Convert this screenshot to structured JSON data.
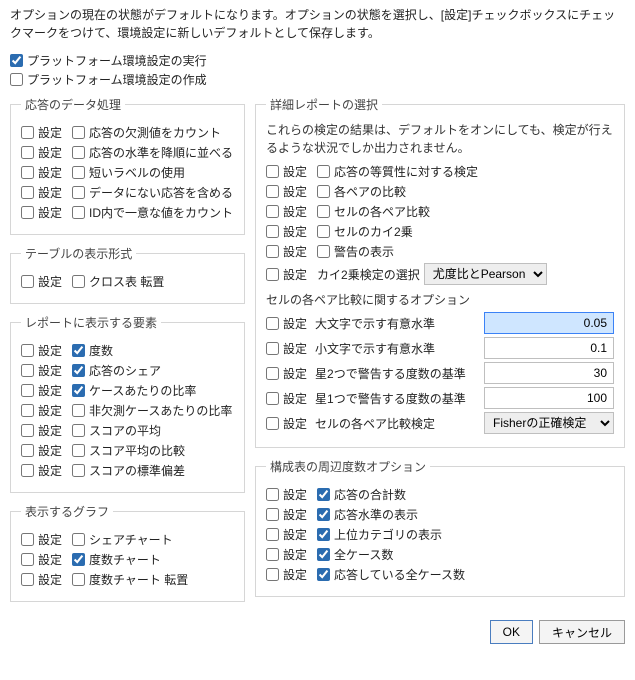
{
  "intro": "オプションの現在の状態がデフォルトになります。オプションの状態を選択し、[設定]チェックボックスにチェックマークをつけて、環境設定に新しいデフォルトとして保存します。",
  "set_label": "設定",
  "top": {
    "run": {
      "checked": true,
      "label": "プラットフォーム環境設定の実行"
    },
    "create": {
      "checked": false,
      "label": "プラットフォーム環境設定の作成"
    }
  },
  "group_data": {
    "title": "応答のデータ処理",
    "items": [
      {
        "set": false,
        "on": false,
        "label": "応答の欠測値をカウント"
      },
      {
        "set": false,
        "on": false,
        "label": "応答の水準を降順に並べる"
      },
      {
        "set": false,
        "on": false,
        "label": "短いラベルの使用"
      },
      {
        "set": false,
        "on": false,
        "label": "データにない応答を含める"
      },
      {
        "set": false,
        "on": false,
        "label": "ID内で一意な値をカウント"
      }
    ]
  },
  "group_table": {
    "title": "テーブルの表示形式",
    "items": [
      {
        "set": false,
        "on": false,
        "label": "クロス表 転置"
      }
    ]
  },
  "group_report": {
    "title": "レポートに表示する要素",
    "items": [
      {
        "set": false,
        "on": true,
        "label": "度数"
      },
      {
        "set": false,
        "on": true,
        "label": "応答のシェア"
      },
      {
        "set": false,
        "on": true,
        "label": "ケースあたりの比率"
      },
      {
        "set": false,
        "on": false,
        "label": "非欠測ケースあたりの比率"
      },
      {
        "set": false,
        "on": false,
        "label": "スコアの平均"
      },
      {
        "set": false,
        "on": false,
        "label": "スコア平均の比較"
      },
      {
        "set": false,
        "on": false,
        "label": "スコアの標準偏差"
      }
    ]
  },
  "group_graph": {
    "title": "表示するグラフ",
    "items": [
      {
        "set": false,
        "on": false,
        "label": "シェアチャート"
      },
      {
        "set": false,
        "on": true,
        "label": "度数チャート"
      },
      {
        "set": false,
        "on": false,
        "label": "度数チャート 転置"
      }
    ]
  },
  "group_detail": {
    "title": "詳細レポートの選択",
    "desc": "これらの検定の結果は、デフォルトをオンにしても、検定が行えるような状況でしか出力されません。",
    "items": [
      {
        "set": false,
        "on": false,
        "label": "応答の等質性に対する検定"
      },
      {
        "set": false,
        "on": false,
        "label": "各ペアの比較"
      },
      {
        "set": false,
        "on": false,
        "label": "セルの各ペア比較"
      },
      {
        "set": false,
        "on": false,
        "label": "セルのカイ2乗"
      },
      {
        "set": false,
        "on": false,
        "label": "警告の表示"
      }
    ],
    "chi_row": {
      "set": false,
      "label": "カイ2乗検定の選択",
      "select": "尤度比とPearson"
    },
    "pair_header": "セルの各ペア比較に関するオプション",
    "val_rows": [
      {
        "set": false,
        "label": "大文字で示す有意水準",
        "value": "0.05",
        "focus": true
      },
      {
        "set": false,
        "label": "小文字で示す有意水準",
        "value": "0.1",
        "focus": false
      },
      {
        "set": false,
        "label": "星2つで警告する度数の基準",
        "value": "30",
        "focus": false
      },
      {
        "set": false,
        "label": "星1つで警告する度数の基準",
        "value": "100",
        "focus": false
      }
    ],
    "test_row": {
      "set": false,
      "label": "セルの各ペア比較検定",
      "select": "Fisherの正確検定"
    }
  },
  "group_margin": {
    "title": "構成表の周辺度数オプション",
    "items": [
      {
        "set": false,
        "on": true,
        "label": "応答の合計数"
      },
      {
        "set": false,
        "on": true,
        "label": "応答水準の表示"
      },
      {
        "set": false,
        "on": true,
        "label": "上位カテゴリの表示"
      },
      {
        "set": false,
        "on": true,
        "label": "全ケース数"
      },
      {
        "set": false,
        "on": true,
        "label": "応答している全ケース数"
      }
    ]
  },
  "buttons": {
    "ok": "OK",
    "cancel": "キャンセル"
  }
}
